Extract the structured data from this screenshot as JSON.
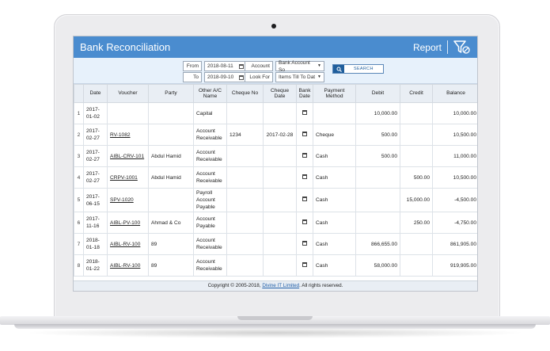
{
  "app": {
    "title": "Bank Reconciliation",
    "report_label": "Report"
  },
  "filters": {
    "from_label": "From",
    "from_value": "2018-08-11",
    "to_label": "To",
    "to_value": "2018-09-10",
    "account_label": "Account",
    "account_value": "Bank Account So",
    "lookfor_label": "Look For",
    "lookfor_value": "Items Till To Dat",
    "search_label": "SEARCH"
  },
  "table": {
    "headers": [
      "",
      "Date",
      "Voucher",
      "Party",
      "Other A/C Name",
      "Cheque No",
      "Cheque Date",
      "Bank Date",
      "Payment Method",
      "Debit",
      "Credit",
      "Balance"
    ],
    "rows": [
      {
        "idx": "1",
        "date": "2017-01-02",
        "voucher": "",
        "party": "",
        "other": "Capital",
        "cheque_no": "",
        "cheque_date": "",
        "method": "",
        "debit": "10,000.00",
        "credit": "",
        "balance": "10,000.00"
      },
      {
        "idx": "2",
        "date": "2017-02-27",
        "voucher": "RV-1082",
        "party": "",
        "other": "Account Receivable",
        "cheque_no": "1234",
        "cheque_date": "2017-02-28",
        "method": "Cheque",
        "debit": "500.00",
        "credit": "",
        "balance": "10,500.00"
      },
      {
        "idx": "3",
        "date": "2017-02-27",
        "voucher": "AIBL-CRV-101",
        "party": "Abdul Hamid",
        "other": "Account Receivable",
        "cheque_no": "",
        "cheque_date": "",
        "method": "Cash",
        "debit": "500.00",
        "credit": "",
        "balance": "11,000.00"
      },
      {
        "idx": "4",
        "date": "2017-02-27",
        "voucher": "CRPV-1001",
        "party": "Abdul Hamid",
        "other": "Account Receivable",
        "cheque_no": "",
        "cheque_date": "",
        "method": "Cash",
        "debit": "",
        "credit": "500.00",
        "balance": "10,500.00"
      },
      {
        "idx": "5",
        "date": "2017-06-15",
        "voucher": "SPV-1020",
        "party": "",
        "other": "Payroll Account Payable",
        "cheque_no": "",
        "cheque_date": "",
        "method": "Cash",
        "debit": "",
        "credit": "15,000.00",
        "balance": "-4,500.00"
      },
      {
        "idx": "6",
        "date": "2017-11-16",
        "voucher": "AIBL-PV-100",
        "party": "Ahmad & Co",
        "other": "Account Payable",
        "cheque_no": "",
        "cheque_date": "",
        "method": "Cash",
        "debit": "",
        "credit": "250.00",
        "balance": "-4,750.00"
      },
      {
        "idx": "7",
        "date": "2018-01-18",
        "voucher": "AIBL-RV-100",
        "party": "89",
        "other": "Account Receivable",
        "cheque_no": "",
        "cheque_date": "",
        "method": "Cash",
        "debit": "866,655.00",
        "credit": "",
        "balance": "861,905.00"
      },
      {
        "idx": "8",
        "date": "2018-01-22",
        "voucher": "AIBL-RV-100",
        "party": "89",
        "other": "Account Receivable",
        "cheque_no": "",
        "cheque_date": "",
        "method": "Cash",
        "debit": "58,000.00",
        "credit": "",
        "balance": "919,905.00"
      }
    ]
  },
  "footer": {
    "prefix": "Copyright © 2005-2018,",
    "link": "Divine IT Limited",
    "suffix": ". All rights reserved."
  },
  "colors": {
    "header_blue": "#4a8ccf",
    "filter_bg": "#e7f1fb",
    "accent_dark": "#1f5e9c"
  }
}
